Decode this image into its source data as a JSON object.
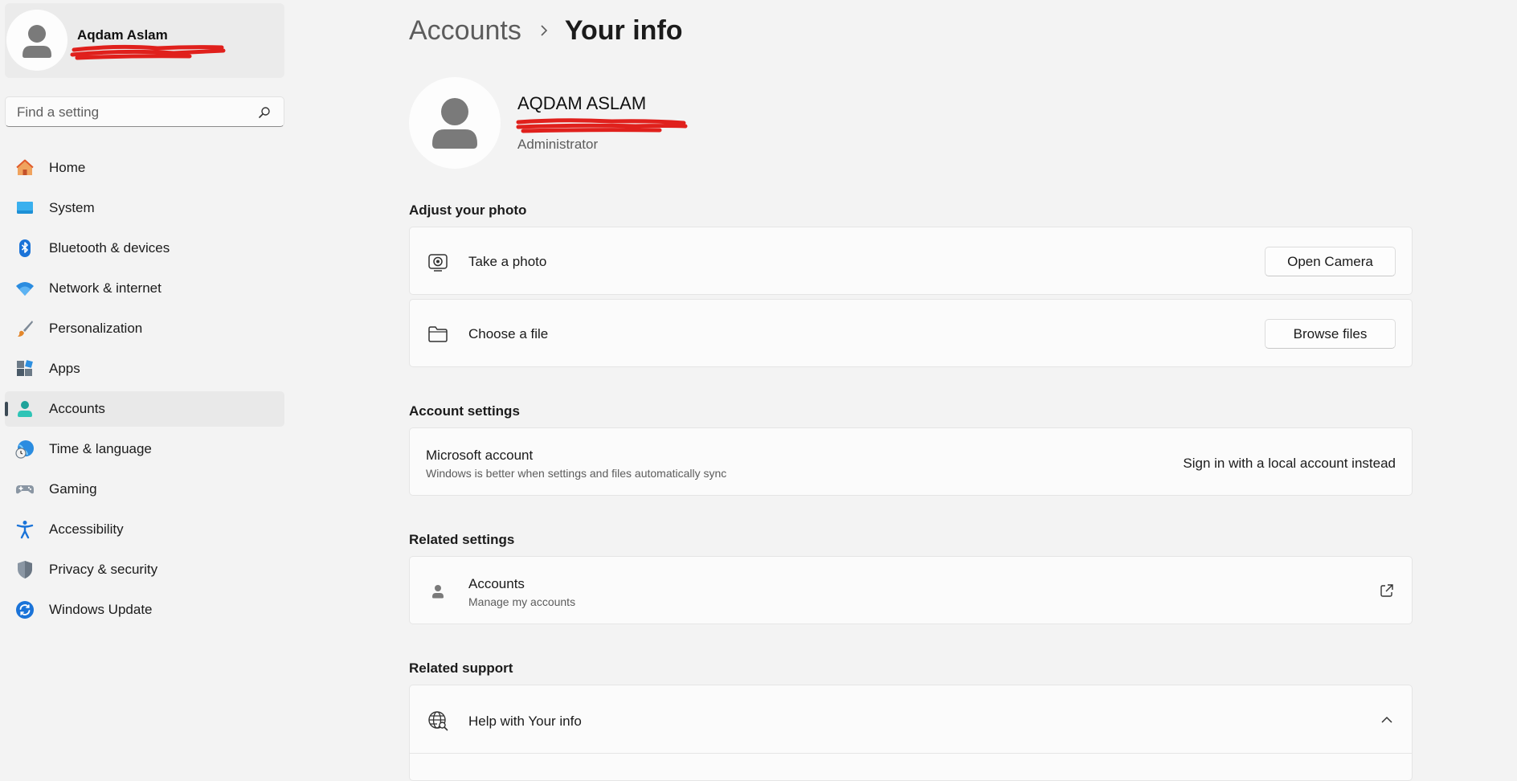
{
  "sidebar": {
    "profile": {
      "name": "Aqdam Aslam"
    },
    "search": {
      "placeholder": "Find a setting"
    },
    "items": [
      {
        "label": "Home",
        "icon": "home-icon"
      },
      {
        "label": "System",
        "icon": "system-icon"
      },
      {
        "label": "Bluetooth & devices",
        "icon": "bluetooth-icon"
      },
      {
        "label": "Network & internet",
        "icon": "wifi-icon"
      },
      {
        "label": "Personalization",
        "icon": "paintbrush-icon"
      },
      {
        "label": "Apps",
        "icon": "apps-icon"
      },
      {
        "label": "Accounts",
        "icon": "accounts-icon",
        "selected": true
      },
      {
        "label": "Time & language",
        "icon": "globe-clock-icon"
      },
      {
        "label": "Gaming",
        "icon": "gamepad-icon"
      },
      {
        "label": "Accessibility",
        "icon": "accessibility-icon"
      },
      {
        "label": "Privacy & security",
        "icon": "shield-icon"
      },
      {
        "label": "Windows Update",
        "icon": "update-icon"
      }
    ]
  },
  "header": {
    "breadcrumb_parent": "Accounts",
    "breadcrumb_current": "Your info"
  },
  "user": {
    "name": "AQDAM ASLAM",
    "role": "Administrator"
  },
  "adjust_photo": {
    "title": "Adjust your photo",
    "take_photo": {
      "label": "Take a photo",
      "button": "Open Camera",
      "icon": "camera-icon"
    },
    "choose_file": {
      "label": "Choose a file",
      "button": "Browse files",
      "icon": "folder-icon"
    }
  },
  "account_settings": {
    "title": "Account settings",
    "microsoft_account": {
      "label": "Microsoft account",
      "description": "Windows is better when settings and files automatically sync",
      "action": "Sign in with a local account instead"
    }
  },
  "related_settings": {
    "title": "Related settings",
    "accounts": {
      "label": "Accounts",
      "description": "Manage my accounts",
      "icon": "person-icon"
    }
  },
  "related_support": {
    "title": "Related support",
    "help": {
      "label": "Help with Your info",
      "icon": "globe-search-icon"
    }
  },
  "colors": {
    "background": "#f3f3f3",
    "card": "#fbfbfb",
    "accent_redaction": "#e0201c",
    "selected_indicator": "#3c4a55"
  }
}
